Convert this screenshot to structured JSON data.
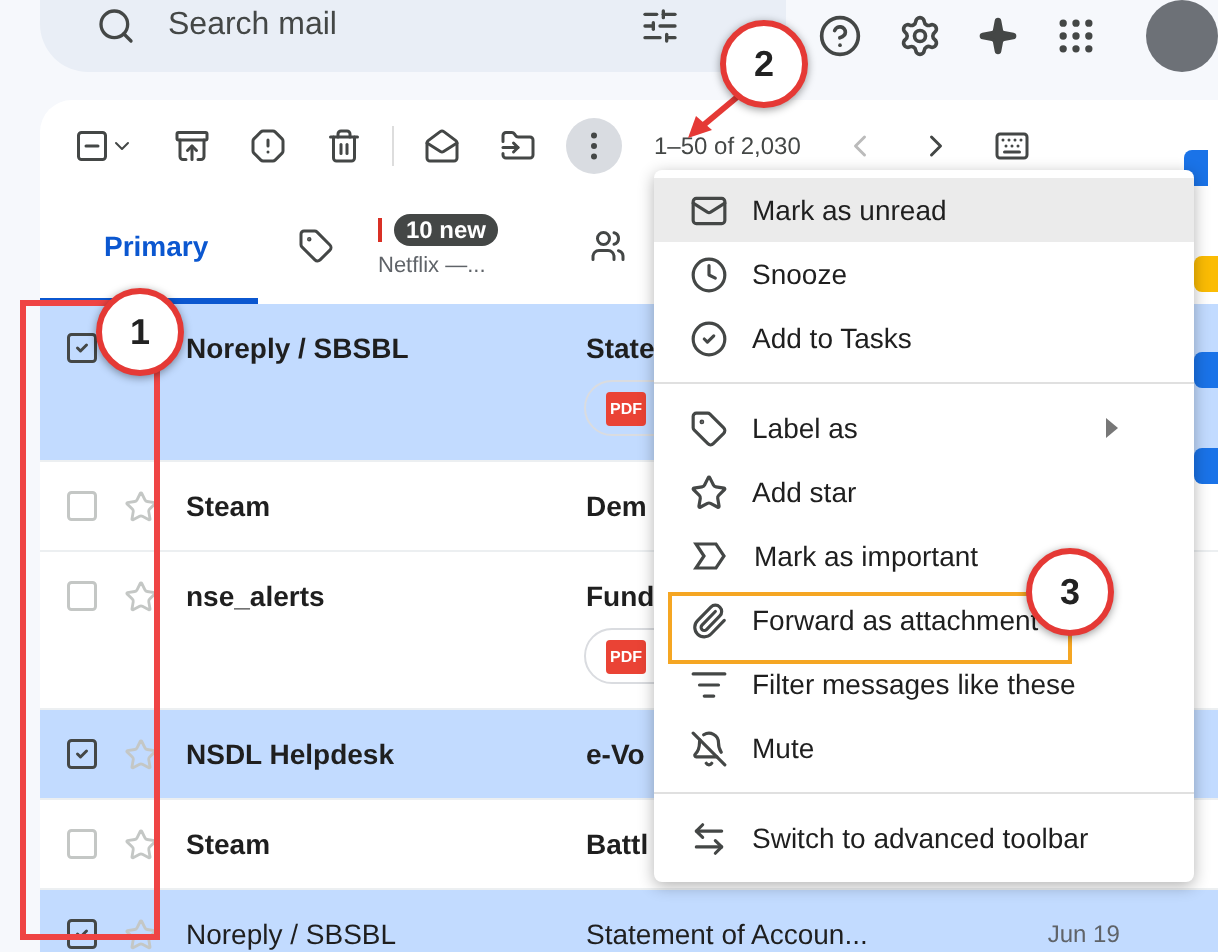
{
  "search": {
    "placeholder": "Search mail"
  },
  "toolbar": {
    "pagination": "1–50 of 2,030",
    "more_selected": true,
    "select_partial": true
  },
  "tabs": [
    {
      "kind": "primary",
      "label": "Primary",
      "selected": true
    },
    {
      "kind": "promotions",
      "badge": "10 new",
      "preview": "Netflix —...",
      "selected": false
    },
    {
      "kind": "social",
      "selected": false
    }
  ],
  "emails": [
    {
      "sender": "Noreply / SBSBL",
      "subject": "State",
      "checked": true,
      "unread": true,
      "attachment": "PDF"
    },
    {
      "sender": "Steam",
      "subject": "Dem",
      "checked": false,
      "unread": true
    },
    {
      "sender": "nse_alerts",
      "subject": "Fund",
      "checked": false,
      "unread": true,
      "attachment": "PDF"
    },
    {
      "sender": "NSDL Helpdesk",
      "subject": "e-Vo",
      "checked": true,
      "unread": true
    },
    {
      "sender": "Steam",
      "subject": "Battl",
      "checked": false,
      "unread": true
    },
    {
      "sender": "Noreply / SBSBL",
      "subject": "Statement of Accoun...",
      "date": "Jun 19",
      "checked": true,
      "unread": false
    }
  ],
  "menu": {
    "groups": [
      [
        {
          "label": "Mark as unread",
          "highlighted": true,
          "submenu": false
        },
        {
          "label": "Snooze",
          "highlighted": false,
          "submenu": false
        },
        {
          "label": "Add to Tasks",
          "highlighted": false,
          "submenu": false
        }
      ],
      [
        {
          "label": "Label as",
          "highlighted": false,
          "submenu": true
        },
        {
          "label": "Add star",
          "highlighted": false,
          "submenu": false
        },
        {
          "label": "Mark as important",
          "highlighted": false,
          "submenu": false
        },
        {
          "label": "Forward as attachment",
          "highlighted": false,
          "submenu": false
        },
        {
          "label": "Filter messages like these",
          "highlighted": false,
          "submenu": false
        },
        {
          "label": "Mute",
          "highlighted": false,
          "submenu": false
        }
      ],
      [
        {
          "label": "Switch to advanced toolbar",
          "highlighted": false,
          "submenu": false
        }
      ]
    ]
  },
  "annotations": [
    {
      "label": "1"
    },
    {
      "label": "2"
    },
    {
      "label": "3"
    }
  ]
}
